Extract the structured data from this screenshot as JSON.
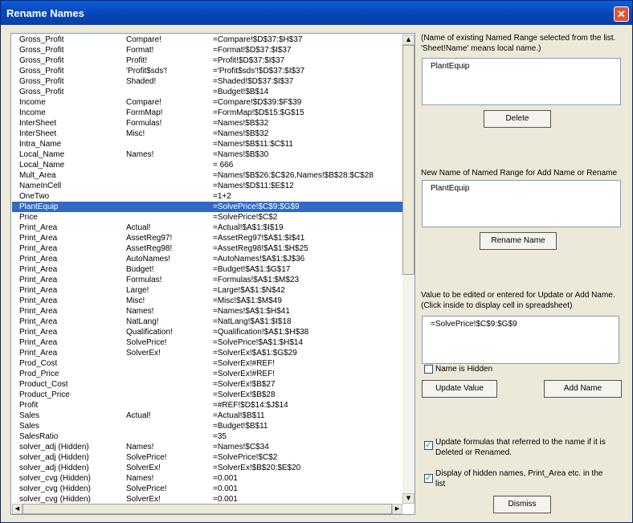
{
  "window": {
    "title": "Rename Names",
    "close_label": "✕"
  },
  "list": {
    "rows": [
      [
        "Gross_Profit",
        "Compare!",
        "=Compare!$D$37:$H$37"
      ],
      [
        "Gross_Profit",
        "Format!",
        "=Format!$D$37:$I$37"
      ],
      [
        "Gross_Profit",
        "Profit!",
        "=Profit!$D$37:$I$37"
      ],
      [
        "Gross_Profit",
        "'Profit$sds'!",
        "='Profit$sds'!$D$37:$I$37"
      ],
      [
        "Gross_Profit",
        "Shaded!",
        "=Shaded!$D$37:$I$37"
      ],
      [
        "Gross_Profit",
        "",
        "=Budget!$B$14"
      ],
      [
        "Income",
        "Compare!",
        "=Compare!$D$39:$F$39"
      ],
      [
        "Income",
        "FormMap!",
        "=FormMap!$D$15:$G$15"
      ],
      [
        "InterSheet",
        "Formulas!",
        "=Names!$B$32"
      ],
      [
        "InterSheet",
        "Misc!",
        "=Names!$B$32"
      ],
      [
        "Intra_Name",
        "",
        "=Names!$B$11:$C$11"
      ],
      [
        "Local_Name",
        "Names!",
        "=Names!$B$30"
      ],
      [
        "Local_Name",
        "",
        "= 666"
      ],
      [
        "Mult_Area",
        "",
        "=Names!$B$26:$C$26,Names!$B$28:$C$28"
      ],
      [
        "NameInCell",
        "",
        "=Names!$D$11:$E$12"
      ],
      [
        "OneTwo",
        "",
        "=1+2"
      ],
      [
        "PlantEquip",
        "",
        "=SolvePrice!$C$9:$G$9"
      ],
      [
        "Price",
        "",
        "=SolvePrice!$C$2"
      ],
      [
        "Print_Area",
        "Actual!",
        "=Actual!$A$1:$I$19"
      ],
      [
        "Print_Area",
        "AssetReg97!",
        "=AssetReg97!$A$1:$I$41"
      ],
      [
        "Print_Area",
        "AssetReg98!",
        "=AssetReg98!$A$1:$H$25"
      ],
      [
        "Print_Area",
        "AutoNames!",
        "=AutoNames!$A$1:$J$36"
      ],
      [
        "Print_Area",
        "Budget!",
        "=Budget!$A$1:$G$17"
      ],
      [
        "Print_Area",
        "Formulas!",
        "=Formulas!$A$1:$M$23"
      ],
      [
        "Print_Area",
        "Large!",
        "=Large!$A$1:$N$42"
      ],
      [
        "Print_Area",
        "Misc!",
        "=Misc!$A$1:$M$49"
      ],
      [
        "Print_Area",
        "Names!",
        "=Names!$A$1:$H$41"
      ],
      [
        "Print_Area",
        "NatLang!",
        "=NatLang!$A$1:$I$18"
      ],
      [
        "Print_Area",
        "Qualification!",
        "=Qualification!$A$1:$H$38"
      ],
      [
        "Print_Area",
        "SolvePrice!",
        "=SolvePrice!$A$1:$H$14"
      ],
      [
        "Print_Area",
        "SolverEx!",
        "=SolverEx!$A$1:$G$29"
      ],
      [
        "Prod_Cost",
        "",
        "=SolverEx!#REF!"
      ],
      [
        "Prod_Price",
        "",
        "=SolverEx!#REF!"
      ],
      [
        "Product_Cost",
        "",
        "=SolverEx!$B$27"
      ],
      [
        "Product_Price",
        "",
        "=SolverEx!$B$28"
      ],
      [
        "Profit",
        "",
        "=#REF!$D$14:$J$14"
      ],
      [
        "Sales",
        "Actual!",
        "=Actual!$B$11"
      ],
      [
        "Sales",
        "",
        "=Budget!$B$11"
      ],
      [
        "SalesRatio",
        "",
        "=35"
      ],
      [
        "solver_adj (Hidden)",
        "Names!",
        "=Names!$C$34"
      ],
      [
        "solver_adj (Hidden)",
        "SolvePrice!",
        "=SolvePrice!$C$2"
      ],
      [
        "solver_adj (Hidden)",
        "SolverEx!",
        "=SolverEx!$B$20:$E$20"
      ],
      [
        "solver_cvg (Hidden)",
        "Names!",
        "=0.001"
      ],
      [
        "solver_cvg (Hidden)",
        "SolvePrice!",
        "=0.001"
      ],
      [
        "solver_cvg (Hidden)",
        "SolverEx!",
        "=0.001"
      ]
    ],
    "selected_index": 16
  },
  "panel": {
    "existing_label": "(Name of existing Named Range selected from the list.  'Sheet!Name' means local name.)",
    "existing_value": "PlantEquip",
    "delete_label": "Delete",
    "new_name_label": "New Name of Named Range for Add Name or Rename",
    "new_name_value": "PlantEquip",
    "rename_label": "Rename Name",
    "value_label": "Value to be edited or entered for Update or Add Name.  (Click inside to display cell in spreadsheet)",
    "value_value": "=SolvePrice!$C$9:$G$9",
    "hidden_label": "Name is Hidden",
    "update_value_label": "Update Value",
    "add_name_label": "Add Name",
    "update_formulas_label": "Update formulas that referred to the name if it is Deleted or Renamed.",
    "display_hidden_label": "Display of hidden names, Print_Area etc. in the list",
    "dismiss_label": "Dismiss",
    "hidden_checked": false,
    "update_formulas_checked": true,
    "display_hidden_checked": true
  }
}
